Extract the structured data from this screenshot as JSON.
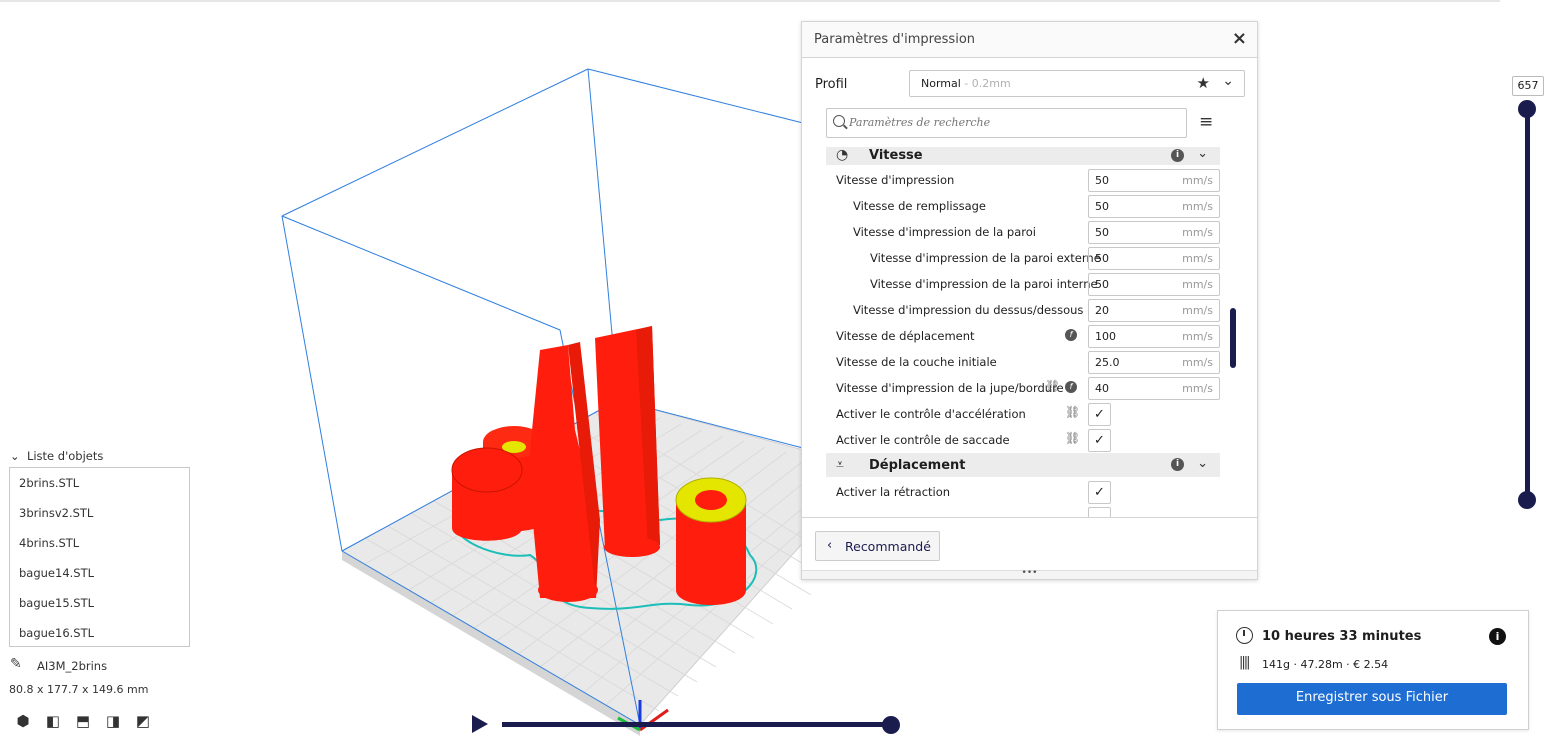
{
  "settings_panel": {
    "title": "Paramètres d'impression",
    "close_icon": "×",
    "profile_label": "Profil",
    "profile_name": "Normal",
    "profile_suffix": " - 0.2mm",
    "search_placeholder": "Paramètres de recherche",
    "categories": [
      {
        "label": "Vitesse",
        "icon": "speedometer-icon"
      },
      {
        "label": "Déplacement",
        "icon": "travel-icon"
      }
    ],
    "speed_rows": [
      {
        "label": "Vitesse d'impression",
        "value": "50",
        "unit": "mm/s"
      },
      {
        "label": "Vitesse de remplissage",
        "value": "50",
        "unit": "mm/s"
      },
      {
        "label": "Vitesse d'impression de la paroi",
        "value": "50",
        "unit": "mm/s"
      },
      {
        "label": "Vitesse d'impression de la paroi externe",
        "value": "50",
        "unit": "mm/s"
      },
      {
        "label": "Vitesse d'impression de la paroi interne",
        "value": "50",
        "unit": "mm/s"
      },
      {
        "label": "Vitesse d'impression du dessus/dessous",
        "value": "20",
        "unit": "mm/s"
      },
      {
        "label": "Vitesse de déplacement",
        "value": "100",
        "unit": "mm/s"
      },
      {
        "label": "Vitesse de la couche initiale",
        "value": "25.0",
        "unit": "mm/s"
      },
      {
        "label": "Vitesse d'impression de la jupe/bordure",
        "value": "40",
        "unit": "mm/s"
      },
      {
        "label": "Activer le contrôle d'accélération",
        "checked": true
      },
      {
        "label": "Activer le contrôle de saccade",
        "checked": true
      }
    ],
    "travel_rows": [
      {
        "label": "Activer la rétraction",
        "checked": true
      }
    ],
    "recommended_label": "Recommandé"
  },
  "object_list": {
    "header": "Liste d'objets",
    "items": [
      "2brins.STL",
      "3brinsv2.STL",
      "4brins.STL",
      "bague14.STL",
      "bague15.STL",
      "bague16.STL"
    ],
    "mesh_name": "AI3M_2brins",
    "dimensions": "80.8 x 177.7 x 149.6 mm"
  },
  "layer_view": {
    "current_layer": "657"
  },
  "print_info": {
    "time": "10 heures 33 minutes",
    "material": "141g · 47.28m · € 2.54",
    "save_label": "Enregistrer sous Fichier"
  },
  "colors": {
    "accent": "#1d6dd3",
    "slider": "#1a1c4e",
    "model": "#ff1e0e",
    "build_volume": "#2f7fe0"
  }
}
